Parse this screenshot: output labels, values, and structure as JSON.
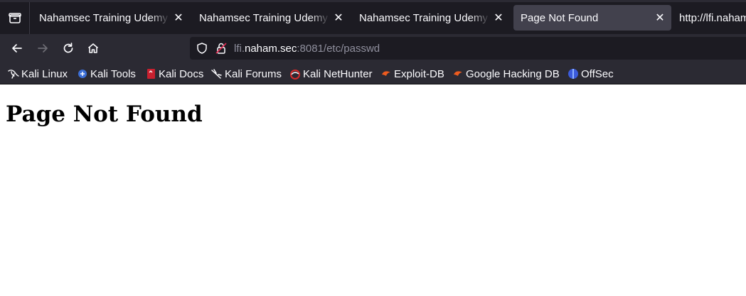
{
  "tabs": [
    {
      "title": "Nahamsec Training Udemy C",
      "active": false
    },
    {
      "title": "Nahamsec Training Udemy C",
      "active": false
    },
    {
      "title": "Nahamsec Training Udemy C",
      "active": false
    },
    {
      "title": "Page Not Found",
      "active": true
    },
    {
      "title": "http://lfi.naham",
      "active": false
    }
  ],
  "tab_close_glyph": "✕",
  "url": {
    "subdomain": "lfi.",
    "host": "naham.sec",
    "rest": ":8081/etc/passwd"
  },
  "bookmarks": [
    {
      "label": "Kali Linux",
      "icon": "kali-dragon-icon"
    },
    {
      "label": "Kali Tools",
      "icon": "kali-tools-icon"
    },
    {
      "label": "Kali Docs",
      "icon": "kali-docs-icon"
    },
    {
      "label": "Kali Forums",
      "icon": "kali-forums-icon"
    },
    {
      "label": "Kali NetHunter",
      "icon": "nethunter-icon"
    },
    {
      "label": "Exploit-DB",
      "icon": "exploit-db-icon"
    },
    {
      "label": "Google Hacking DB",
      "icon": "ghdb-icon"
    },
    {
      "label": "OffSec",
      "icon": "offsec-icon"
    }
  ],
  "page": {
    "heading": "Page Not Found"
  },
  "colors": {
    "chrome_dark": "#1c1b22",
    "chrome": "#2b2a33",
    "active_tab": "#42414d",
    "text": "#fbfbfe"
  }
}
